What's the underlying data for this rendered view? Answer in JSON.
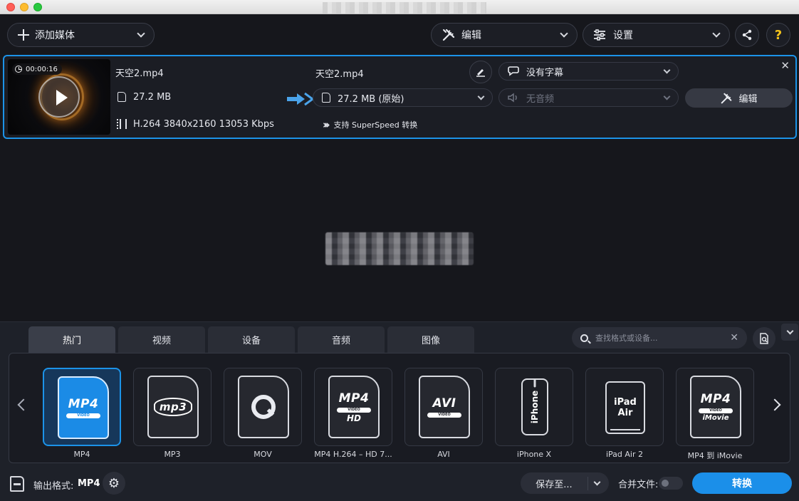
{
  "toolbar": {
    "add_media": "添加媒体",
    "edit": "编辑",
    "settings": "设置",
    "help": "?"
  },
  "file": {
    "duration": "00:00:16",
    "source_name": "天空2.mp4",
    "source_size": "27.2 MB",
    "source_codec": "H.264 3840x2160 13053 Kbps",
    "output_name": "天空2.mp4",
    "output_size": "27.2 MB (原始)",
    "superspeed": "支持 SuperSpeed 转换",
    "subtitles": "没有字幕",
    "audio": "无音频",
    "edit_button": "编辑",
    "close": "✕"
  },
  "tabs": [
    "热门",
    "视频",
    "设备",
    "音频",
    "图像"
  ],
  "search": {
    "placeholder": "查找格式或设备..."
  },
  "formats": [
    {
      "label": "MP4",
      "icon": "mp4-video-icon",
      "big": "MP4",
      "band": "VIDEO",
      "sub": ""
    },
    {
      "label": "MP3",
      "icon": "mp3-icon",
      "big": "mp3",
      "band": "",
      "sub": ""
    },
    {
      "label": "MOV",
      "icon": "quicktime-icon",
      "big": "",
      "band": "",
      "sub": ""
    },
    {
      "label": "MP4 H.264 – HD 7...",
      "icon": "mp4-hd-icon",
      "big": "MP4",
      "band": "VIDEO",
      "sub": "HD"
    },
    {
      "label": "AVI",
      "icon": "avi-video-icon",
      "big": "AVI",
      "band": "VIDEO",
      "sub": ""
    },
    {
      "label": "iPhone X",
      "icon": "iphone-icon",
      "big": "iPhone",
      "band": "",
      "sub": ""
    },
    {
      "label": "iPad Air 2",
      "icon": "ipad-icon",
      "big": "iPad",
      "band": "",
      "sub": "Air"
    },
    {
      "label": "MP4 到 iMovie",
      "icon": "mp4-imovie-icon",
      "big": "MP4",
      "band": "VIDEO",
      "sub": "iMovie"
    }
  ],
  "footer": {
    "output_format_label": "输出格式:",
    "output_format_value": "MP4",
    "save_to": "保存至...",
    "merge_files": "合并文件:",
    "convert": "转换"
  },
  "colors": {
    "accent": "#1b8fe9",
    "background": "#16171c",
    "panel": "#1e2129"
  }
}
